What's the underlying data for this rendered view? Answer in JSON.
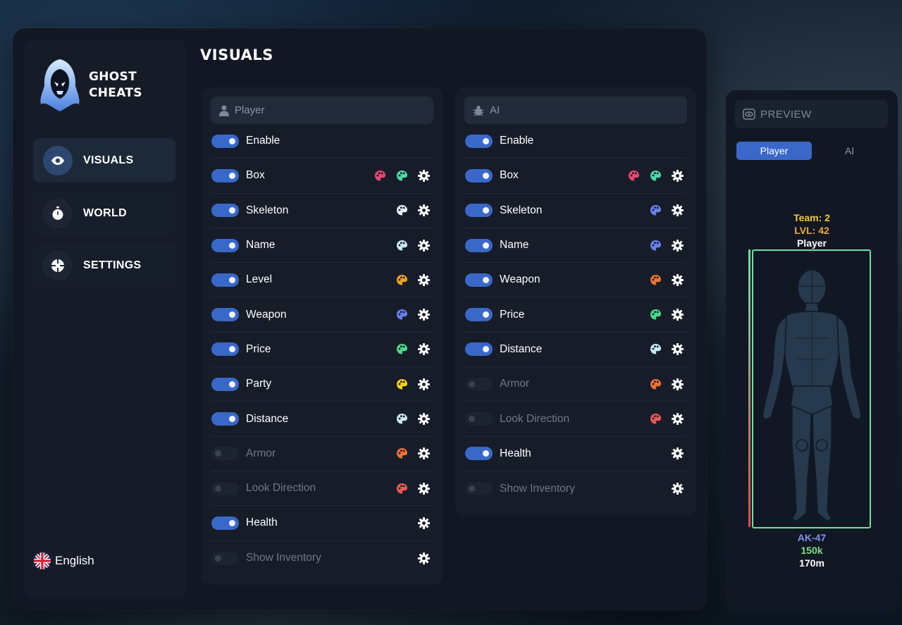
{
  "brand": {
    "line1": "GHOST",
    "line2": "CHEATS"
  },
  "colors": {
    "accent": "#3a68c9",
    "pink": "#e8466f",
    "mint": "#4ed8a0",
    "white": "#e9eef5",
    "lightblue": "#c9e7f5",
    "orange": "#f0a020",
    "blue": "#6a7ff0",
    "green": "#4ed88c",
    "yellow": "#f5d21a",
    "deeporange": "#f07035",
    "red": "#f05a55",
    "team": "#f5c842",
    "level": "#f0a642",
    "weapon": "#7d8ff0",
    "price": "#7de08a",
    "health_box": "#6ee0a0",
    "health_bar": "#e34b4b"
  },
  "sidebar": {
    "items": [
      {
        "label": "VISUALS",
        "icon": "eye-icon",
        "active": true
      },
      {
        "label": "WORLD",
        "icon": "stopwatch-icon",
        "active": false
      },
      {
        "label": "SETTINGS",
        "icon": "crosshair-icon",
        "active": false
      }
    ],
    "language": {
      "label": "English",
      "icon": "uk-flag-icon"
    }
  },
  "page": {
    "title": "VISUALS"
  },
  "player_panel": {
    "header": "Player",
    "header_icon": "user-icon",
    "rows": [
      {
        "label": "Enable",
        "enabled": true,
        "palettes": [],
        "settings": false
      },
      {
        "label": "Box",
        "enabled": true,
        "palettes": [
          "pink",
          "mint"
        ],
        "settings": true
      },
      {
        "label": "Skeleton",
        "enabled": true,
        "palettes": [
          "white"
        ],
        "settings": true
      },
      {
        "label": "Name",
        "enabled": true,
        "palettes": [
          "lightblue"
        ],
        "settings": true
      },
      {
        "label": "Level",
        "enabled": true,
        "palettes": [
          "orange"
        ],
        "settings": true
      },
      {
        "label": "Weapon",
        "enabled": true,
        "palettes": [
          "blue"
        ],
        "settings": true
      },
      {
        "label": "Price",
        "enabled": true,
        "palettes": [
          "green"
        ],
        "settings": true
      },
      {
        "label": "Party",
        "enabled": true,
        "palettes": [
          "yellow"
        ],
        "settings": true
      },
      {
        "label": "Distance",
        "enabled": true,
        "palettes": [
          "lightblue"
        ],
        "settings": true
      },
      {
        "label": "Armor",
        "enabled": false,
        "palettes": [
          "deeporange"
        ],
        "settings": true
      },
      {
        "label": "Look Direction",
        "enabled": false,
        "palettes": [
          "red"
        ],
        "settings": true
      },
      {
        "label": "Health",
        "enabled": true,
        "palettes": [],
        "settings": true
      },
      {
        "label": "Show Inventory",
        "enabled": false,
        "palettes": [],
        "settings": true
      }
    ]
  },
  "ai_panel": {
    "header": "AI",
    "header_icon": "bug-icon",
    "rows": [
      {
        "label": "Enable",
        "enabled": true,
        "palettes": [],
        "settings": false
      },
      {
        "label": "Box",
        "enabled": true,
        "palettes": [
          "pink",
          "mint"
        ],
        "settings": true
      },
      {
        "label": "Skeleton",
        "enabled": true,
        "palettes": [
          "blue"
        ],
        "settings": true
      },
      {
        "label": "Name",
        "enabled": true,
        "palettes": [
          "blue"
        ],
        "settings": true
      },
      {
        "label": "Weapon",
        "enabled": true,
        "palettes": [
          "deeporange"
        ],
        "settings": true
      },
      {
        "label": "Price",
        "enabled": true,
        "palettes": [
          "green"
        ],
        "settings": true
      },
      {
        "label": "Distance",
        "enabled": true,
        "palettes": [
          "lightblue"
        ],
        "settings": true
      },
      {
        "label": "Armor",
        "enabled": false,
        "palettes": [
          "deeporange"
        ],
        "settings": true
      },
      {
        "label": "Look Direction",
        "enabled": false,
        "palettes": [
          "red"
        ],
        "settings": true
      },
      {
        "label": "Health",
        "enabled": true,
        "palettes": [],
        "settings": true
      },
      {
        "label": "Show Inventory",
        "enabled": false,
        "palettes": [],
        "settings": true
      }
    ]
  },
  "preview": {
    "header": "PREVIEW",
    "tabs": [
      {
        "label": "Player",
        "active": true
      },
      {
        "label": "AI",
        "active": false
      }
    ],
    "team": "Team: 2",
    "level": "LVL: 42",
    "name": "Player",
    "weapon": "AK-47",
    "price": "150k",
    "distance": "170m",
    "health_fraction": 1.0
  }
}
